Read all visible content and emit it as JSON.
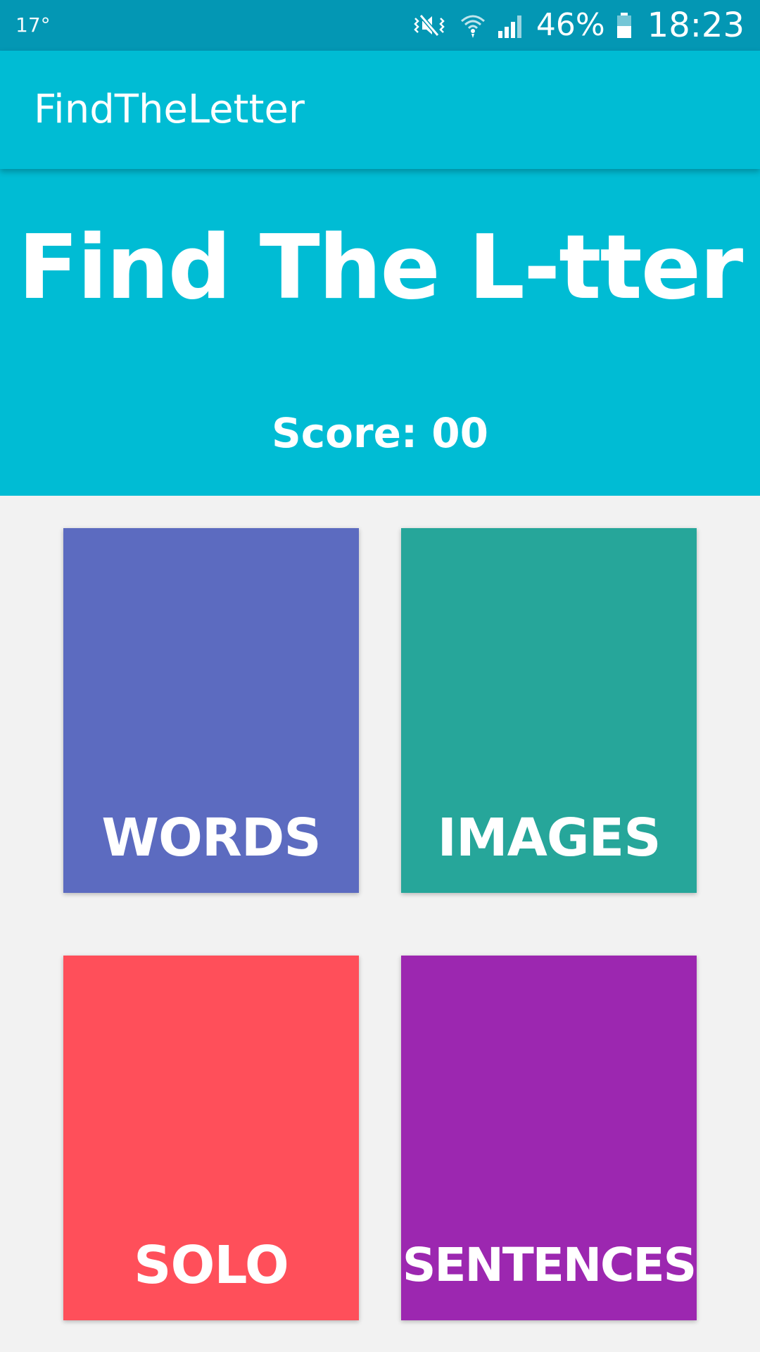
{
  "status_bar": {
    "temperature": "17°",
    "battery_percent": "46%",
    "time": "18:23",
    "icons": [
      "mute-vibrate-icon",
      "wifi-icon",
      "signal-icon",
      "battery-icon"
    ]
  },
  "app_bar": {
    "title": "FindTheLetter",
    "color": "#00bcd4"
  },
  "header": {
    "title": "Find The L-tter",
    "score_label": "Score: 00"
  },
  "cards": [
    {
      "id": "words",
      "label": "WORDS",
      "color": "#5c6bc0"
    },
    {
      "id": "images",
      "label": "IMAGES",
      "color": "#26a69a"
    },
    {
      "id": "solo",
      "label": "SOLO",
      "color": "#ff4f5a"
    },
    {
      "id": "sentences",
      "label": "SENTENCES",
      "color": "#9c27b0"
    }
  ]
}
